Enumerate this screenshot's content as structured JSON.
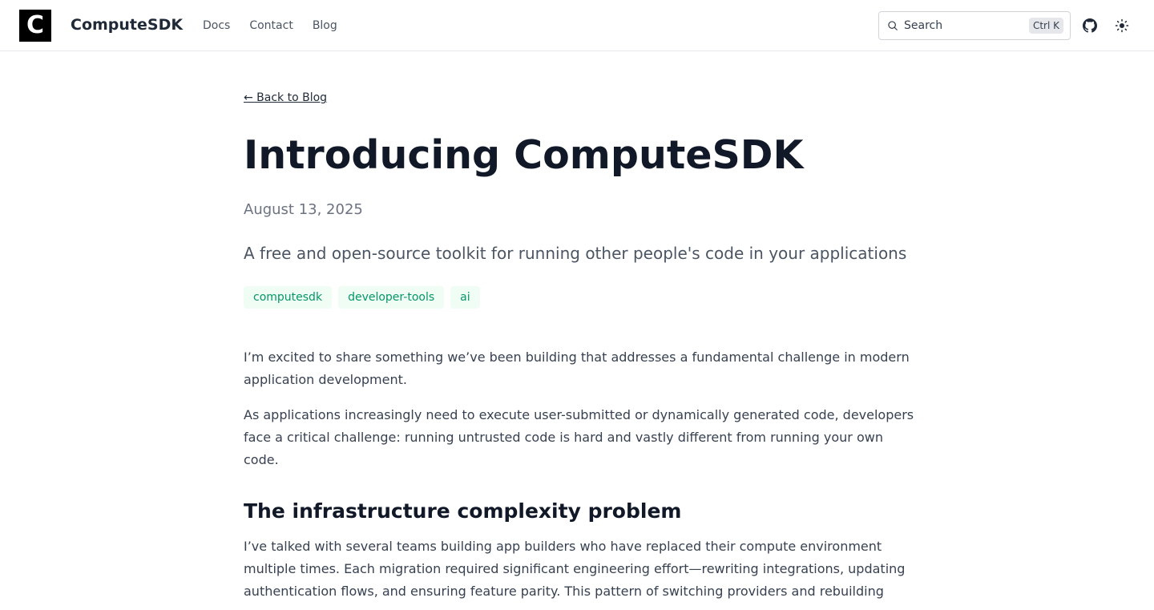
{
  "header": {
    "logo_letter": "C",
    "brand": "ComputeSDK",
    "nav": [
      "Docs",
      "Contact",
      "Blog"
    ],
    "search": {
      "placeholder": "Search",
      "shortcut": "Ctrl K"
    },
    "icons": {
      "search": "search-icon",
      "github": "github-icon",
      "theme": "sun-icon"
    }
  },
  "article": {
    "back_link": "← Back to Blog",
    "title": "Introducing ComputeSDK",
    "date": "August 13, 2025",
    "subtitle": "A free and open-source toolkit for running other people's code in your applications",
    "tags": [
      "computesdk",
      "developer-tools",
      "ai"
    ],
    "paragraphs": [
      "I’m excited to share something we’ve been building that addresses a fundamental challenge in modern application development.",
      "As applications increasingly need to execute user-submitted or dynamically generated code, developers face a critical challenge: running untrusted code is hard and vastly different from running your own code."
    ],
    "section_heading": "The infrastructure complexity problem",
    "section_paragraph": "I’ve talked with several teams building app builders who have replaced their compute environment multiple times. Each migration required significant engineering effort—rewriting integrations, updating authentication flows, and ensuring feature parity. This pattern of switching providers and rebuilding"
  },
  "colors": {
    "tag_bg": "#f0fdf4",
    "tag_text": "#059669",
    "logo_bg": "#000000"
  }
}
